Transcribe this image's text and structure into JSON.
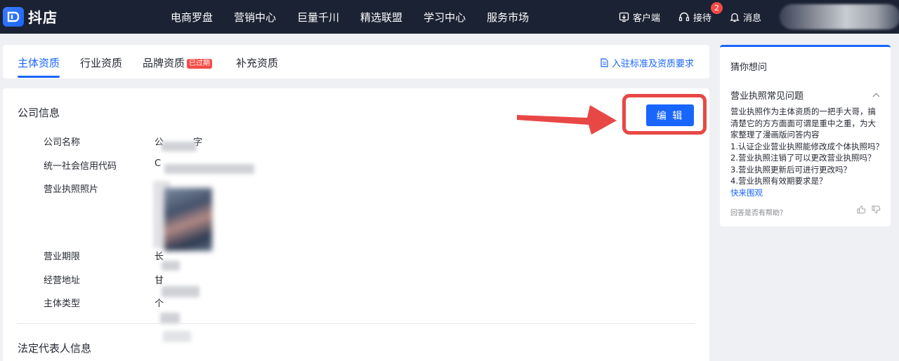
{
  "header": {
    "logo_text": "抖店",
    "nav": [
      "电商罗盘",
      "营销中心",
      "巨量千川",
      "精选联盟",
      "学习中心",
      "服务市场"
    ],
    "client_label": "客户端",
    "reception_label": "接待",
    "reception_badge": "2",
    "message_label": "消息"
  },
  "tabs": {
    "items": [
      "主体资质",
      "行业资质",
      "品牌资质",
      "补充资质"
    ],
    "active_index": 0,
    "expired_tag": "已过期",
    "standard_link": "入驻标准及资质要求"
  },
  "company": {
    "section_title": "公司信息",
    "edit_button": "编 辑",
    "fields": [
      {
        "label": "公司名称",
        "value_prefix": "公",
        "value_suffix": "字"
      },
      {
        "label": "统一社会信用代码",
        "value_prefix": "C"
      },
      {
        "label": "营业执照照片"
      },
      {
        "label": "营业期限",
        "value_prefix": "长"
      },
      {
        "label": "经营地址",
        "value_prefix": "甘"
      },
      {
        "label": "主体类型",
        "value_prefix": "个"
      }
    ]
  },
  "legal_rep": {
    "section_title": "法定代表人信息"
  },
  "sidebar": {
    "title": "猜你想问",
    "faq_title": "营业执照常见问题",
    "faq_intro": "营业执照作为主体资质的一把手大哥，搞清楚它的方方面面可谓是重中之重，为大家整理了漫画版问答内容",
    "faq_items": [
      "1.认证企业营业执照能修改成个体执照吗？",
      "2.营业执照注销了可以更改营业执照吗？",
      "3.营业执照更新后可进行更改吗？",
      "4.营业执照有效期要求是？"
    ],
    "faq_more": "快来围观",
    "helpful_question": "回答是否有帮助？"
  },
  "colors": {
    "accent": "#1966ff",
    "topbar": "#1b2233",
    "badge": "#f54a45",
    "annotation": "#e84845"
  }
}
